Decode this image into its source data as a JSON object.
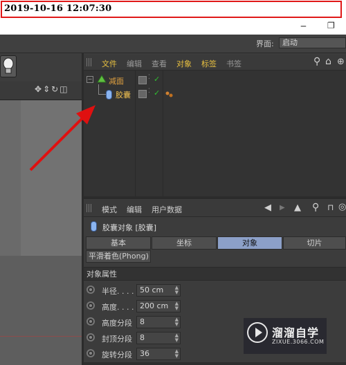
{
  "timestamp": "2019-10-16 12:07:30",
  "window": {
    "minimize": "‒",
    "restore": "❐"
  },
  "layout_selector": {
    "label": "界面:",
    "value": "启动"
  },
  "object_manager": {
    "menu": [
      "文件",
      "编辑",
      "查看",
      "对象",
      "标签",
      "书签"
    ],
    "items": [
      {
        "name": "减面",
        "icon": "polygon-reduction-icon"
      },
      {
        "name": "胶囊",
        "icon": "capsule-icon"
      }
    ]
  },
  "attributes_manager": {
    "menu": [
      "模式",
      "编辑",
      "用户数据"
    ],
    "title": "胶囊对象 [胶囊]",
    "tabs": [
      "基本",
      "坐标",
      "对象",
      "切片"
    ],
    "active_tab": "对象",
    "phong_tab": "平滑着色(Phong)",
    "section": "对象属性",
    "params": [
      {
        "label": "半径. . . .",
        "value": "50 cm"
      },
      {
        "label": "高度. . . .",
        "value": "200 cm"
      },
      {
        "label": "高度分段",
        "value": "8"
      },
      {
        "label": "封顶分段",
        "value": "8"
      },
      {
        "label": "旋转分段",
        "value": "36"
      }
    ]
  },
  "watermark": {
    "title": "溜溜自学",
    "sub": "ZIXUE.3066.COM"
  },
  "colors": {
    "accent_red": "#e01818",
    "active_tab": "#8ca0c8",
    "menu_highlight": "#e8c040",
    "tree_text": "#e0a040"
  }
}
